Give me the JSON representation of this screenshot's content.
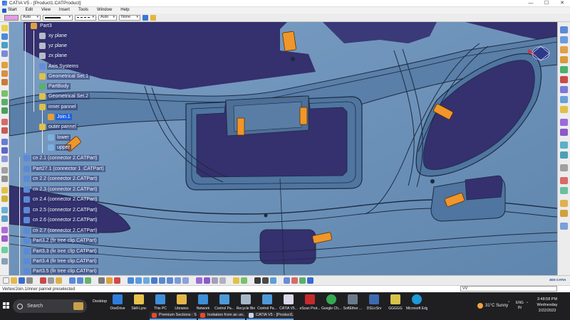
{
  "window": {
    "title": "CATIA V5 - [Product1.CATProduct]",
    "controls": [
      "—",
      "☐",
      "✕"
    ]
  },
  "menu": [
    "Start",
    "Edit",
    "View",
    "Insert",
    "Tools",
    "Window",
    "Help"
  ],
  "properties_bar": {
    "color_swatch": "#e39de3",
    "transparency": "Auto",
    "line_weight": "Auto",
    "line_type_value": "",
    "layer": "None"
  },
  "tree": {
    "nodes": [
      {
        "label": "Part3",
        "icon": "part-gear-icon",
        "highlight": false
      },
      {
        "label": "xy plane",
        "icon": "plane-icon",
        "highlight": false
      },
      {
        "label": "yz plane",
        "icon": "plane-icon",
        "highlight": false
      },
      {
        "label": "zx plane",
        "icon": "plane-icon",
        "highlight": false
      },
      {
        "label": "Axis Systems",
        "icon": "axis-system-icon",
        "highlight": false
      },
      {
        "label": "Geometrical Set.1",
        "icon": "geometrical-set-icon",
        "highlight": false
      },
      {
        "label": "PartBody",
        "icon": "part-body-icon",
        "highlight": false
      },
      {
        "label": "Geometrical Set.2",
        "icon": "geometrical-set-icon",
        "highlight": false
      },
      {
        "label": "inner pannel",
        "icon": "geometrical-set-icon",
        "highlight": false
      },
      {
        "label": "Join.1",
        "icon": "join-icon",
        "highlight": true
      },
      {
        "label": "outer pannel",
        "icon": "geometrical-set-icon",
        "highlight": false
      },
      {
        "label": "lower",
        "icon": "surface-icon",
        "highlight": false
      },
      {
        "label": "upper",
        "icon": "surface-icon",
        "highlight": false
      },
      {
        "label": "cn 2.1 (connector 2.CATPart)",
        "icon": "component-icon",
        "highlight": false
      },
      {
        "label": "Part27.1 (connector 1 .CATPart)",
        "icon": "component-icon",
        "highlight": false
      },
      {
        "label": "cn 2.2 (connector 2.CATPart)",
        "icon": "component-icon",
        "highlight": false
      },
      {
        "label": "cn 2.3 (connector 2.CATPart)",
        "icon": "component-icon",
        "highlight": false
      },
      {
        "label": "cn 2.4 (connector 2.CATPart)",
        "icon": "component-icon",
        "highlight": false
      },
      {
        "label": "cn 2.5 (connector 2.CATPart)",
        "icon": "component-icon",
        "highlight": false
      },
      {
        "label": "cn 2.6 (connector 2.CATPart)",
        "icon": "component-icon",
        "highlight": false
      },
      {
        "label": "cn 2.7 (connector 2.CATPart)",
        "icon": "component-icon",
        "highlight": false
      },
      {
        "label": "Part3.2 (fir tree clip.CATPart)",
        "icon": "component-icon",
        "highlight": false
      },
      {
        "label": "Part3.3 (fir tree clip.CATPart)",
        "icon": "component-icon",
        "highlight": false
      },
      {
        "label": "Part3.4 (fir tree clip.CATPart)",
        "icon": "component-icon",
        "highlight": false
      },
      {
        "label": "Part3.5 (fir tree clip.CATPart)",
        "icon": "component-icon",
        "highlight": false
      }
    ]
  },
  "viewport": {
    "background": "#6a8fb4",
    "surface_color": "#4d77a3",
    "pocket_color": "#35306e",
    "clip_color": "#f0962a",
    "axis_label": "x"
  },
  "brand_logo_text": "3DS CATIA",
  "status": {
    "message": "Vertex/Join.1/inner pannel preselected",
    "command_value": "VV"
  },
  "taskbar": {
    "search_label": "Search",
    "desktop_label": "Desktop",
    "desktop_icons": [
      {
        "label": "OneDrive",
        "color": "#2d7ddc"
      },
      {
        "label": "Skill-Lync",
        "color": "#e9c24a"
      },
      {
        "label": "This PC",
        "color": "#3d8fd8"
      },
      {
        "label": "Libraries",
        "color": "#e4b64a"
      },
      {
        "label": "Network",
        "color": "#3d8fd8"
      },
      {
        "label": "Control Pa...",
        "color": "#4d9ad8"
      },
      {
        "label": "Recycle Bin",
        "color": "#a6b8c8"
      },
      {
        "label": "Control Pa...",
        "color": "#4d9ad8"
      },
      {
        "label": "CATIA V5...",
        "color": "#d8d8e8"
      },
      {
        "label": "eScan Prot...",
        "color": "#c62a2a"
      },
      {
        "label": "Google Ch...",
        "color": "#35a853"
      },
      {
        "label": "SoftEther ...",
        "color": "#6a7a8a"
      },
      {
        "label": "DSLicSrv",
        "color": "#3c6ab0"
      },
      {
        "label": "GGGGG",
        "color": "#d8c24a"
      },
      {
        "label": "Microsoft Edge",
        "color": "#1d9ad8"
      }
    ],
    "tasks": [
      {
        "label": "Premium Sections : S...",
        "color": "#e44a2a"
      },
      {
        "label": "Invitation from an un...",
        "color": "#e44a2a"
      },
      {
        "label": "CATIA V5 - [Product1...",
        "color": "#c8d4e8"
      }
    ],
    "weather": "31°C  Sunny",
    "lang": "ENG",
    "region": "IN",
    "time": "3:48:58 PM",
    "day": "Wednesday",
    "date": "2/22/2023"
  }
}
